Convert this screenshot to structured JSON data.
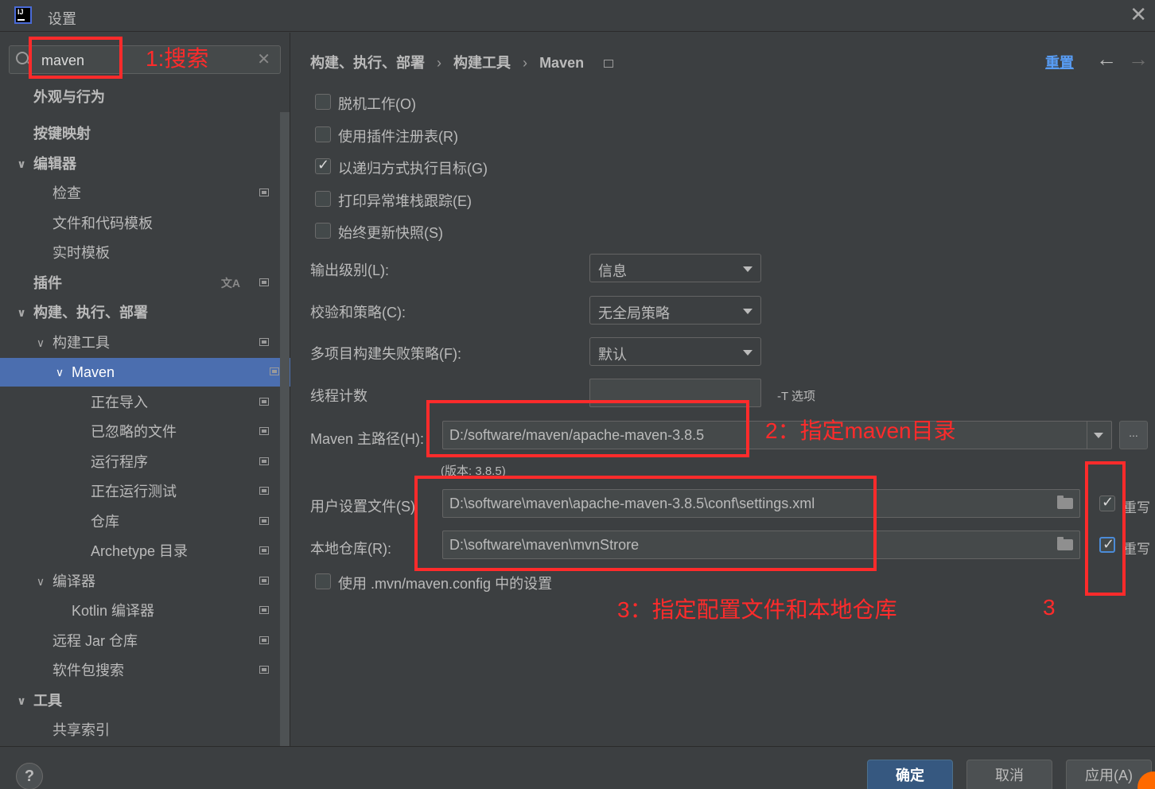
{
  "window": {
    "title": "设置"
  },
  "search": {
    "value": "maven"
  },
  "tree": [
    {
      "label": "外观与行为",
      "bold": true
    },
    {
      "label": "按键映射",
      "bold": true
    },
    {
      "label": "编辑器",
      "bold": true,
      "expanded": true
    },
    {
      "label": "检查"
    },
    {
      "label": "文件和代码模板"
    },
    {
      "label": "实时模板"
    },
    {
      "label": "插件",
      "bold": true
    },
    {
      "label": "构建、执行、部署",
      "bold": true,
      "expanded": true
    },
    {
      "label": "构建工具",
      "expanded": true
    },
    {
      "label": "Maven",
      "expanded": true,
      "selected": true
    },
    {
      "label": "正在导入"
    },
    {
      "label": "已忽略的文件"
    },
    {
      "label": "运行程序"
    },
    {
      "label": "正在运行测试"
    },
    {
      "label": "仓库"
    },
    {
      "label": "Archetype 目录"
    },
    {
      "label": "编译器",
      "expanded": true
    },
    {
      "label": "Kotlin 编译器"
    },
    {
      "label": "远程 Jar 仓库"
    },
    {
      "label": "软件包搜索"
    },
    {
      "label": "工具",
      "bold": true,
      "expanded": true
    },
    {
      "label": "共享索引"
    }
  ],
  "breadcrumb": {
    "part1": "构建、执行、部署",
    "part2": "构建工具",
    "part3": "Maven",
    "sep": "›"
  },
  "header": {
    "reset": "重置",
    "back": "←",
    "forward": "→"
  },
  "checkboxes": {
    "offline": {
      "label": "脱机工作(O)",
      "checked": false
    },
    "plugin_registry": {
      "label": "使用插件注册表(R)",
      "checked": false
    },
    "recursive": {
      "label": "以递归方式执行目标(G)",
      "checked": true
    },
    "print_stack": {
      "label": "打印异常堆栈跟踪(E)",
      "checked": false
    },
    "always_update": {
      "label": "始终更新快照(S)",
      "checked": false
    },
    "use_mvn_config": {
      "label": "使用 .mvn/maven.config 中的设置",
      "checked": false
    }
  },
  "form": {
    "output_level": {
      "label": "输出级别(L):",
      "value": "信息"
    },
    "checksum_policy": {
      "label": "校验和策略(C):",
      "value": "无全局策略"
    },
    "multiproject_fail": {
      "label": "多项目构建失败策略(F):",
      "value": "默认"
    },
    "thread_count": {
      "label": "线程计数",
      "value": "",
      "suffix": "-T 选项"
    },
    "maven_home": {
      "label": "Maven 主路径(H):",
      "value": "D:/software/maven/apache-maven-3.8.5",
      "version": "(版本: 3.8.5)",
      "browse": "..."
    },
    "user_settings": {
      "label": "用户设置文件(S)",
      "value": "D:\\software\\maven\\apache-maven-3.8.5\\conf\\settings.xml",
      "override_label": "重写",
      "override": true
    },
    "local_repo": {
      "label": "本地仓库(R):",
      "value": "D:\\software\\maven\\mvnStrore",
      "override_label": "重写",
      "override": true
    }
  },
  "annotations": {
    "a1": "1:搜索",
    "a2": "2：指定maven目录",
    "a3": "3：指定配置文件和本地仓库",
    "a3b": "3"
  },
  "footer": {
    "help": "?",
    "ok": "确定",
    "cancel": "取消",
    "apply": "应用(A)"
  }
}
